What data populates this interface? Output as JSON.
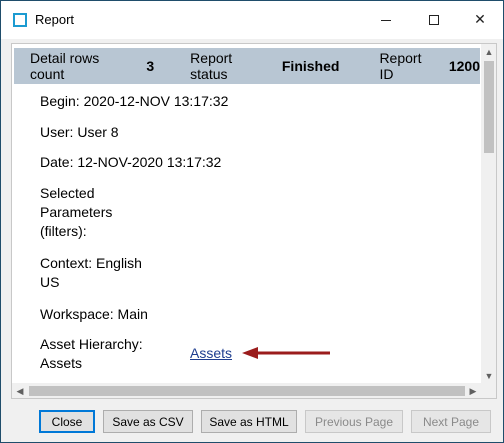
{
  "window": {
    "title": "Report",
    "minimize_glyph": "",
    "maximize_glyph": "",
    "close_glyph": "✕"
  },
  "header": {
    "detail_rows_label": "Detail rows count",
    "detail_rows_value": "3",
    "status_label": "Report status",
    "status_value": "Finished",
    "report_id_label": "Report ID",
    "report_id_value": "1200"
  },
  "fields": {
    "begin": "Begin: 2020-12-NOV 13:17:32",
    "user": "User: User 8",
    "date": "Date: 12-NOV-2020 13:17:32",
    "selected_parameters": "Selected Parameters (filters):",
    "context": "Context: English US",
    "workspace": "Workspace: Main",
    "asset_hierarchy": "Asset Hierarchy: Assets"
  },
  "asset_link": "Assets",
  "arrow_color": "#9b1c1c",
  "buttons": {
    "close": "Close",
    "save_csv": "Save as CSV",
    "save_html": "Save as HTML",
    "previous_page": "Previous Page",
    "next_page": "Next Page"
  },
  "icons": {
    "app": "window-app-icon",
    "scroll_up": "chevron-up-icon",
    "scroll_down": "chevron-down-icon",
    "scroll_left": "chevron-left-icon",
    "scroll_right": "chevron-right-icon"
  }
}
